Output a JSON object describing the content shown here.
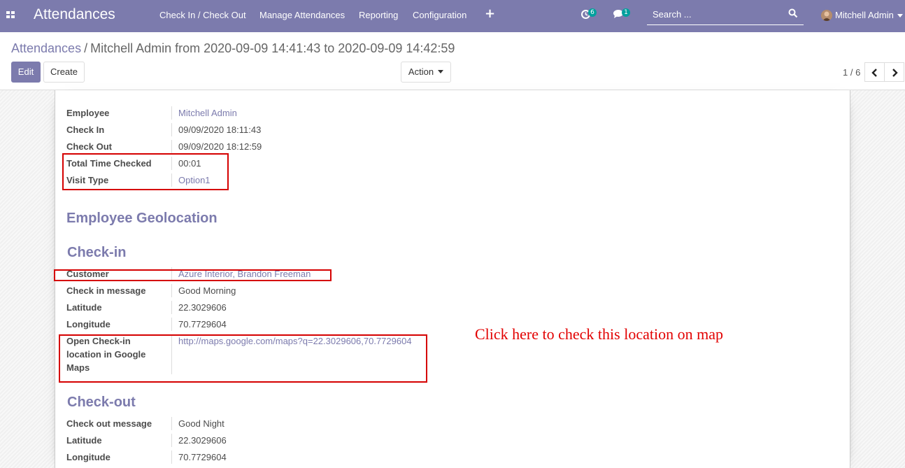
{
  "navbar": {
    "app_title": "Attendances",
    "menu": [
      "Check In / Check Out",
      "Manage Attendances",
      "Reporting",
      "Configuration"
    ],
    "activity_count": "6",
    "message_count": "1",
    "search_placeholder": "Search ...",
    "user_name": "Mitchell Admin",
    "accent_color": "#7c7bad"
  },
  "breadcrumb": {
    "parent": "Attendances",
    "separator": "/",
    "current": "Mitchell Admin from 2020-09-09 14:41:43 to 2020-09-09 14:42:59"
  },
  "buttons": {
    "edit": "Edit",
    "create": "Create",
    "action": "Action"
  },
  "pager": {
    "value": "1 / 6"
  },
  "form": {
    "general": [
      {
        "label": "Employee",
        "value": "Mitchell Admin"
      },
      {
        "label": "Check In",
        "value": "09/09/2020 18:11:43"
      },
      {
        "label": "Check Out",
        "value": "09/09/2020 18:12:59"
      },
      {
        "label": "Total Time Checked",
        "value": "00:01"
      },
      {
        "label": "Visit Type",
        "value": "Option1"
      }
    ],
    "geolocation_title": "Employee Geolocation",
    "checkin_title": "Check-in",
    "checkin": [
      {
        "label": "Customer",
        "value": "Azure Interior, Brandon Freeman"
      },
      {
        "label": "Check in message",
        "value": "Good Morning"
      },
      {
        "label": "Latitude",
        "value": "22.3029606"
      },
      {
        "label": "Longitude",
        "value": "70.7729604"
      },
      {
        "label_lines": [
          "Open Check-in",
          "location in Google",
          "Maps"
        ],
        "value": "http://maps.google.com/maps?q=22.3029606,70.7729604"
      }
    ],
    "checkout_title": "Check-out",
    "checkout": [
      {
        "label": "Check out message",
        "value": "Good Night"
      },
      {
        "label": "Latitude",
        "value": "22.3029606"
      },
      {
        "label": "Longitude",
        "value": "70.7729604"
      }
    ]
  },
  "annotation": {
    "text": "Click here to check this location on map",
    "color": "#e20000"
  }
}
